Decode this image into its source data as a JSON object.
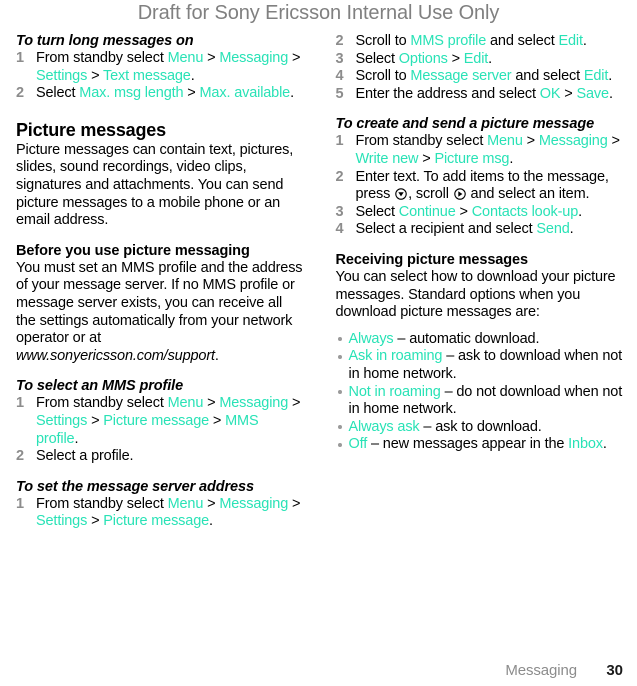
{
  "header": {
    "watermark": "Draft for Sony Ericsson Internal Use Only"
  },
  "colors": {
    "link_teal": "#29e2b6",
    "watermark_gray": "#808080",
    "step_number_gray": "#8c8c8c",
    "bullet_gray": "#9a9a9a",
    "body_black": "#000000"
  },
  "left_column": {
    "proc_long_messages": {
      "title": "To turn long messages on",
      "steps": [
        {
          "num": "1",
          "parts": [
            {
              "t": "From standby select ",
              "s": "plain"
            },
            {
              "t": "Menu",
              "s": "ui"
            },
            {
              "t": " > ",
              "s": "plain"
            },
            {
              "t": "Messaging",
              "s": "ui"
            },
            {
              "t": " > ",
              "s": "plain"
            },
            {
              "t": "Settings",
              "s": "ui"
            },
            {
              "t": " > ",
              "s": "plain"
            },
            {
              "t": "Text message",
              "s": "ui"
            },
            {
              "t": ".",
              "s": "plain"
            }
          ]
        },
        {
          "num": "2",
          "parts": [
            {
              "t": "Select ",
              "s": "plain"
            },
            {
              "t": "Max. msg length",
              "s": "ui"
            },
            {
              "t": " > ",
              "s": "plain"
            },
            {
              "t": "Max. available",
              "s": "ui"
            },
            {
              "t": ".",
              "s": "plain"
            }
          ]
        }
      ]
    },
    "section_picture_messages": {
      "heading": "Picture messages",
      "body": "Picture messages can contain text, pictures, slides, sound recordings, video clips, signatures and attachments. You can send picture messages to a mobile phone or an email address."
    },
    "before_you_use": {
      "heading": "Before you use picture messaging",
      "parts": [
        {
          "t": "You must set an MMS profile and the address of your message server. If no MMS profile or message server exists, you can receive all the settings automatically from your network operator or at ",
          "s": "plain"
        },
        {
          "t": "www.sonyericsson.com/support",
          "s": "italic"
        },
        {
          "t": ".",
          "s": "plain"
        }
      ]
    },
    "proc_select_mms_profile": {
      "title": "To select an MMS profile",
      "steps": [
        {
          "num": "1",
          "parts": [
            {
              "t": "From standby select ",
              "s": "plain"
            },
            {
              "t": "Menu",
              "s": "ui"
            },
            {
              "t": " > ",
              "s": "plain"
            },
            {
              "t": "Messaging",
              "s": "ui"
            },
            {
              "t": " > ",
              "s": "plain"
            },
            {
              "t": "Settings",
              "s": "ui"
            },
            {
              "t": " > ",
              "s": "plain"
            },
            {
              "t": "Picture message",
              "s": "ui"
            },
            {
              "t": " > ",
              "s": "plain"
            },
            {
              "t": "MMS profile",
              "s": "ui"
            },
            {
              "t": ".",
              "s": "plain"
            }
          ]
        },
        {
          "num": "2",
          "parts": [
            {
              "t": "Select a profile.",
              "s": "plain"
            }
          ]
        }
      ]
    },
    "proc_message_server_address": {
      "title": "To set the message server address",
      "steps": [
        {
          "num": "1",
          "parts": [
            {
              "t": "From standby select ",
              "s": "plain"
            },
            {
              "t": "Menu",
              "s": "ui"
            },
            {
              "t": " > ",
              "s": "plain"
            },
            {
              "t": "Messaging",
              "s": "ui"
            },
            {
              "t": " > ",
              "s": "plain"
            },
            {
              "t": "Settings",
              "s": "ui"
            },
            {
              "t": " > ",
              "s": "plain"
            },
            {
              "t": "Picture message",
              "s": "ui"
            },
            {
              "t": ".",
              "s": "plain"
            }
          ]
        }
      ]
    }
  },
  "right_column": {
    "proc_message_server_address_cont": {
      "steps": [
        {
          "num": "2",
          "parts": [
            {
              "t": "Scroll to ",
              "s": "plain"
            },
            {
              "t": "MMS profile",
              "s": "ui"
            },
            {
              "t": " and select ",
              "s": "plain"
            },
            {
              "t": "Edit",
              "s": "ui"
            },
            {
              "t": ".",
              "s": "plain"
            }
          ]
        },
        {
          "num": "3",
          "parts": [
            {
              "t": "Select ",
              "s": "plain"
            },
            {
              "t": "Options",
              "s": "ui"
            },
            {
              "t": " > ",
              "s": "plain"
            },
            {
              "t": "Edit",
              "s": "ui"
            },
            {
              "t": ".",
              "s": "plain"
            }
          ]
        },
        {
          "num": "4",
          "parts": [
            {
              "t": "Scroll to ",
              "s": "plain"
            },
            {
              "t": "Message server",
              "s": "ui"
            },
            {
              "t": " and select ",
              "s": "plain"
            },
            {
              "t": "Edit",
              "s": "ui"
            },
            {
              "t": ".",
              "s": "plain"
            }
          ]
        },
        {
          "num": "5",
          "parts": [
            {
              "t": "Enter the address and select ",
              "s": "plain"
            },
            {
              "t": "OK",
              "s": "ui"
            },
            {
              "t": " > ",
              "s": "plain"
            },
            {
              "t": "Save",
              "s": "ui"
            },
            {
              "t": ".",
              "s": "plain"
            }
          ]
        }
      ]
    },
    "proc_create_send": {
      "title": "To create and send a picture message",
      "steps": [
        {
          "num": "1",
          "parts": [
            {
              "t": "From standby select ",
              "s": "plain"
            },
            {
              "t": "Menu",
              "s": "ui"
            },
            {
              "t": " > ",
              "s": "plain"
            },
            {
              "t": "Messaging",
              "s": "ui"
            },
            {
              "t": " > ",
              "s": "plain"
            },
            {
              "t": "Write new",
              "s": "ui"
            },
            {
              "t": " > ",
              "s": "plain"
            },
            {
              "t": "Picture msg",
              "s": "ui"
            },
            {
              "t": ".",
              "s": "plain"
            }
          ]
        },
        {
          "num": "2",
          "parts": [
            {
              "t": "Enter text. To add items to the message, press ",
              "s": "plain"
            },
            {
              "t": "",
              "s": "icon-nav-down"
            },
            {
              "t": ", scroll ",
              "s": "plain"
            },
            {
              "t": "",
              "s": "icon-nav-right"
            },
            {
              "t": " and select an item.",
              "s": "plain"
            }
          ]
        },
        {
          "num": "3",
          "parts": [
            {
              "t": "Select ",
              "s": "plain"
            },
            {
              "t": "Continue",
              "s": "ui"
            },
            {
              "t": " > ",
              "s": "plain"
            },
            {
              "t": "Contacts look-up",
              "s": "ui"
            },
            {
              "t": ".",
              "s": "plain"
            }
          ]
        },
        {
          "num": "4",
          "parts": [
            {
              "t": "Select a recipient and select ",
              "s": "plain"
            },
            {
              "t": "Send",
              "s": "ui"
            },
            {
              "t": ".",
              "s": "plain"
            }
          ]
        }
      ]
    },
    "receiving": {
      "heading": "Receiving picture messages",
      "body": "You can select how to download your picture messages. Standard options when you download picture messages are:",
      "options": [
        {
          "parts": [
            {
              "t": "Always",
              "s": "ui"
            },
            {
              "t": " – automatic download.",
              "s": "plain"
            }
          ]
        },
        {
          "parts": [
            {
              "t": "Ask in roaming",
              "s": "ui"
            },
            {
              "t": " – ask to download when not in home network.",
              "s": "plain"
            }
          ]
        },
        {
          "parts": [
            {
              "t": "Not in roaming",
              "s": "ui"
            },
            {
              "t": " – do not download when not in home network.",
              "s": "plain"
            }
          ]
        },
        {
          "parts": [
            {
              "t": "Always ask",
              "s": "ui"
            },
            {
              "t": " – ask to download.",
              "s": "plain"
            }
          ]
        },
        {
          "parts": [
            {
              "t": "Off",
              "s": "ui"
            },
            {
              "t": " – new messages appear in the ",
              "s": "plain"
            },
            {
              "t": "Inbox",
              "s": "ui"
            },
            {
              "t": ".",
              "s": "plain"
            }
          ]
        }
      ]
    }
  },
  "footer": {
    "chapter": "Messaging",
    "page_number": "30"
  },
  "icons": {
    "nav_down": "navigation-key-down-icon",
    "nav_right": "navigation-key-right-icon"
  }
}
